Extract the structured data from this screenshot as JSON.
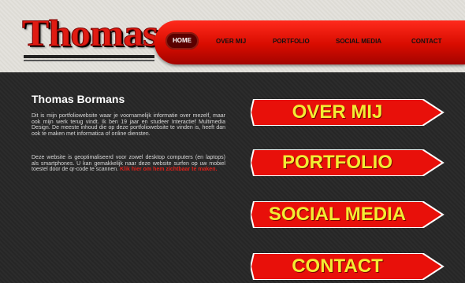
{
  "header": {
    "logo": "Thomas",
    "nav": {
      "home": "HOME",
      "items": [
        "OVER MIJ",
        "PORTFOLIO",
        "SOCIAL MEDIA",
        "CONTACT"
      ]
    }
  },
  "main": {
    "title": "Thomas Bormans",
    "para1": "Dit is mijn portfoliowebsite waar je voornamelijk informatie over mezelf, maar ook mijn werk terug vindt. Ik ben 19 jaar en studeer Interactief Multimedia Design. De meeste inhoud die op deze portfoliowebsite te vinden is, heeft dan ook te maken met informatica of online diensten.",
    "para2": "Deze website is geoptimaliseerd voor zowel desktop computers (en laptops) als smartphones. U kan gemakkelijk naar deze website surfen op uw mobiel toestel door de qr-code te scannen.",
    "para2_link": "Klik hier om hem zichtbaar te maken."
  },
  "buttons": [
    "OVER MIJ",
    "PORTFOLIO",
    "SOCIAL MEDIA",
    "CONTACT"
  ],
  "colors": {
    "accent": "#e01b12",
    "button_text": "#f3ec33",
    "background": "#2a2a2a"
  }
}
